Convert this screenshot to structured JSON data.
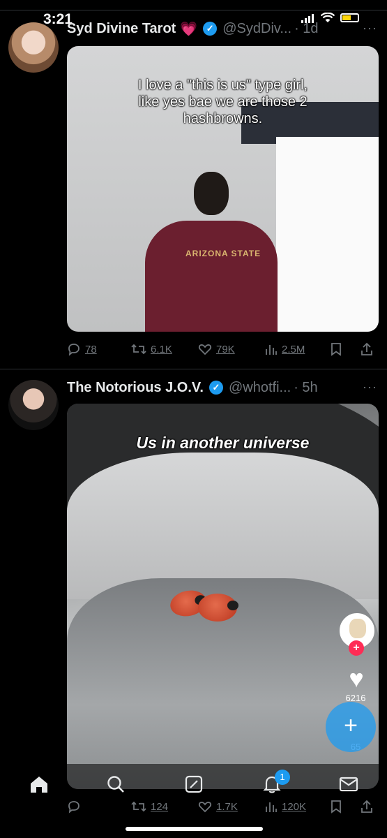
{
  "status_bar": {
    "time": "3:21"
  },
  "tweets": [
    {
      "display_name": "Syd Divine Tarot",
      "name_emoji": "💗",
      "handle": "@SydDiv...",
      "time": "· 1d",
      "more": "···",
      "media_caption": "I love a \"this is us\" type girl,\nlike yes bae we are those 2\nhashbrowns.",
      "shirt_text": "ARIZONA STATE",
      "actions": {
        "replies": "78",
        "retweets": "6.1K",
        "likes": "79K",
        "views": "2.5M"
      }
    },
    {
      "display_name": "The Notorious J.O.V.",
      "handle": "@whotfi...",
      "time": "· 5h",
      "more": "···",
      "media_caption": "Us in another universe",
      "tiktok": {
        "likes": "6216",
        "comments": "65"
      },
      "actions": {
        "replies": "",
        "retweets": "124",
        "likes": "1.7K",
        "views": "120K"
      }
    }
  ],
  "bottom_nav": {
    "notification_badge": "1"
  },
  "fab_label": "+"
}
